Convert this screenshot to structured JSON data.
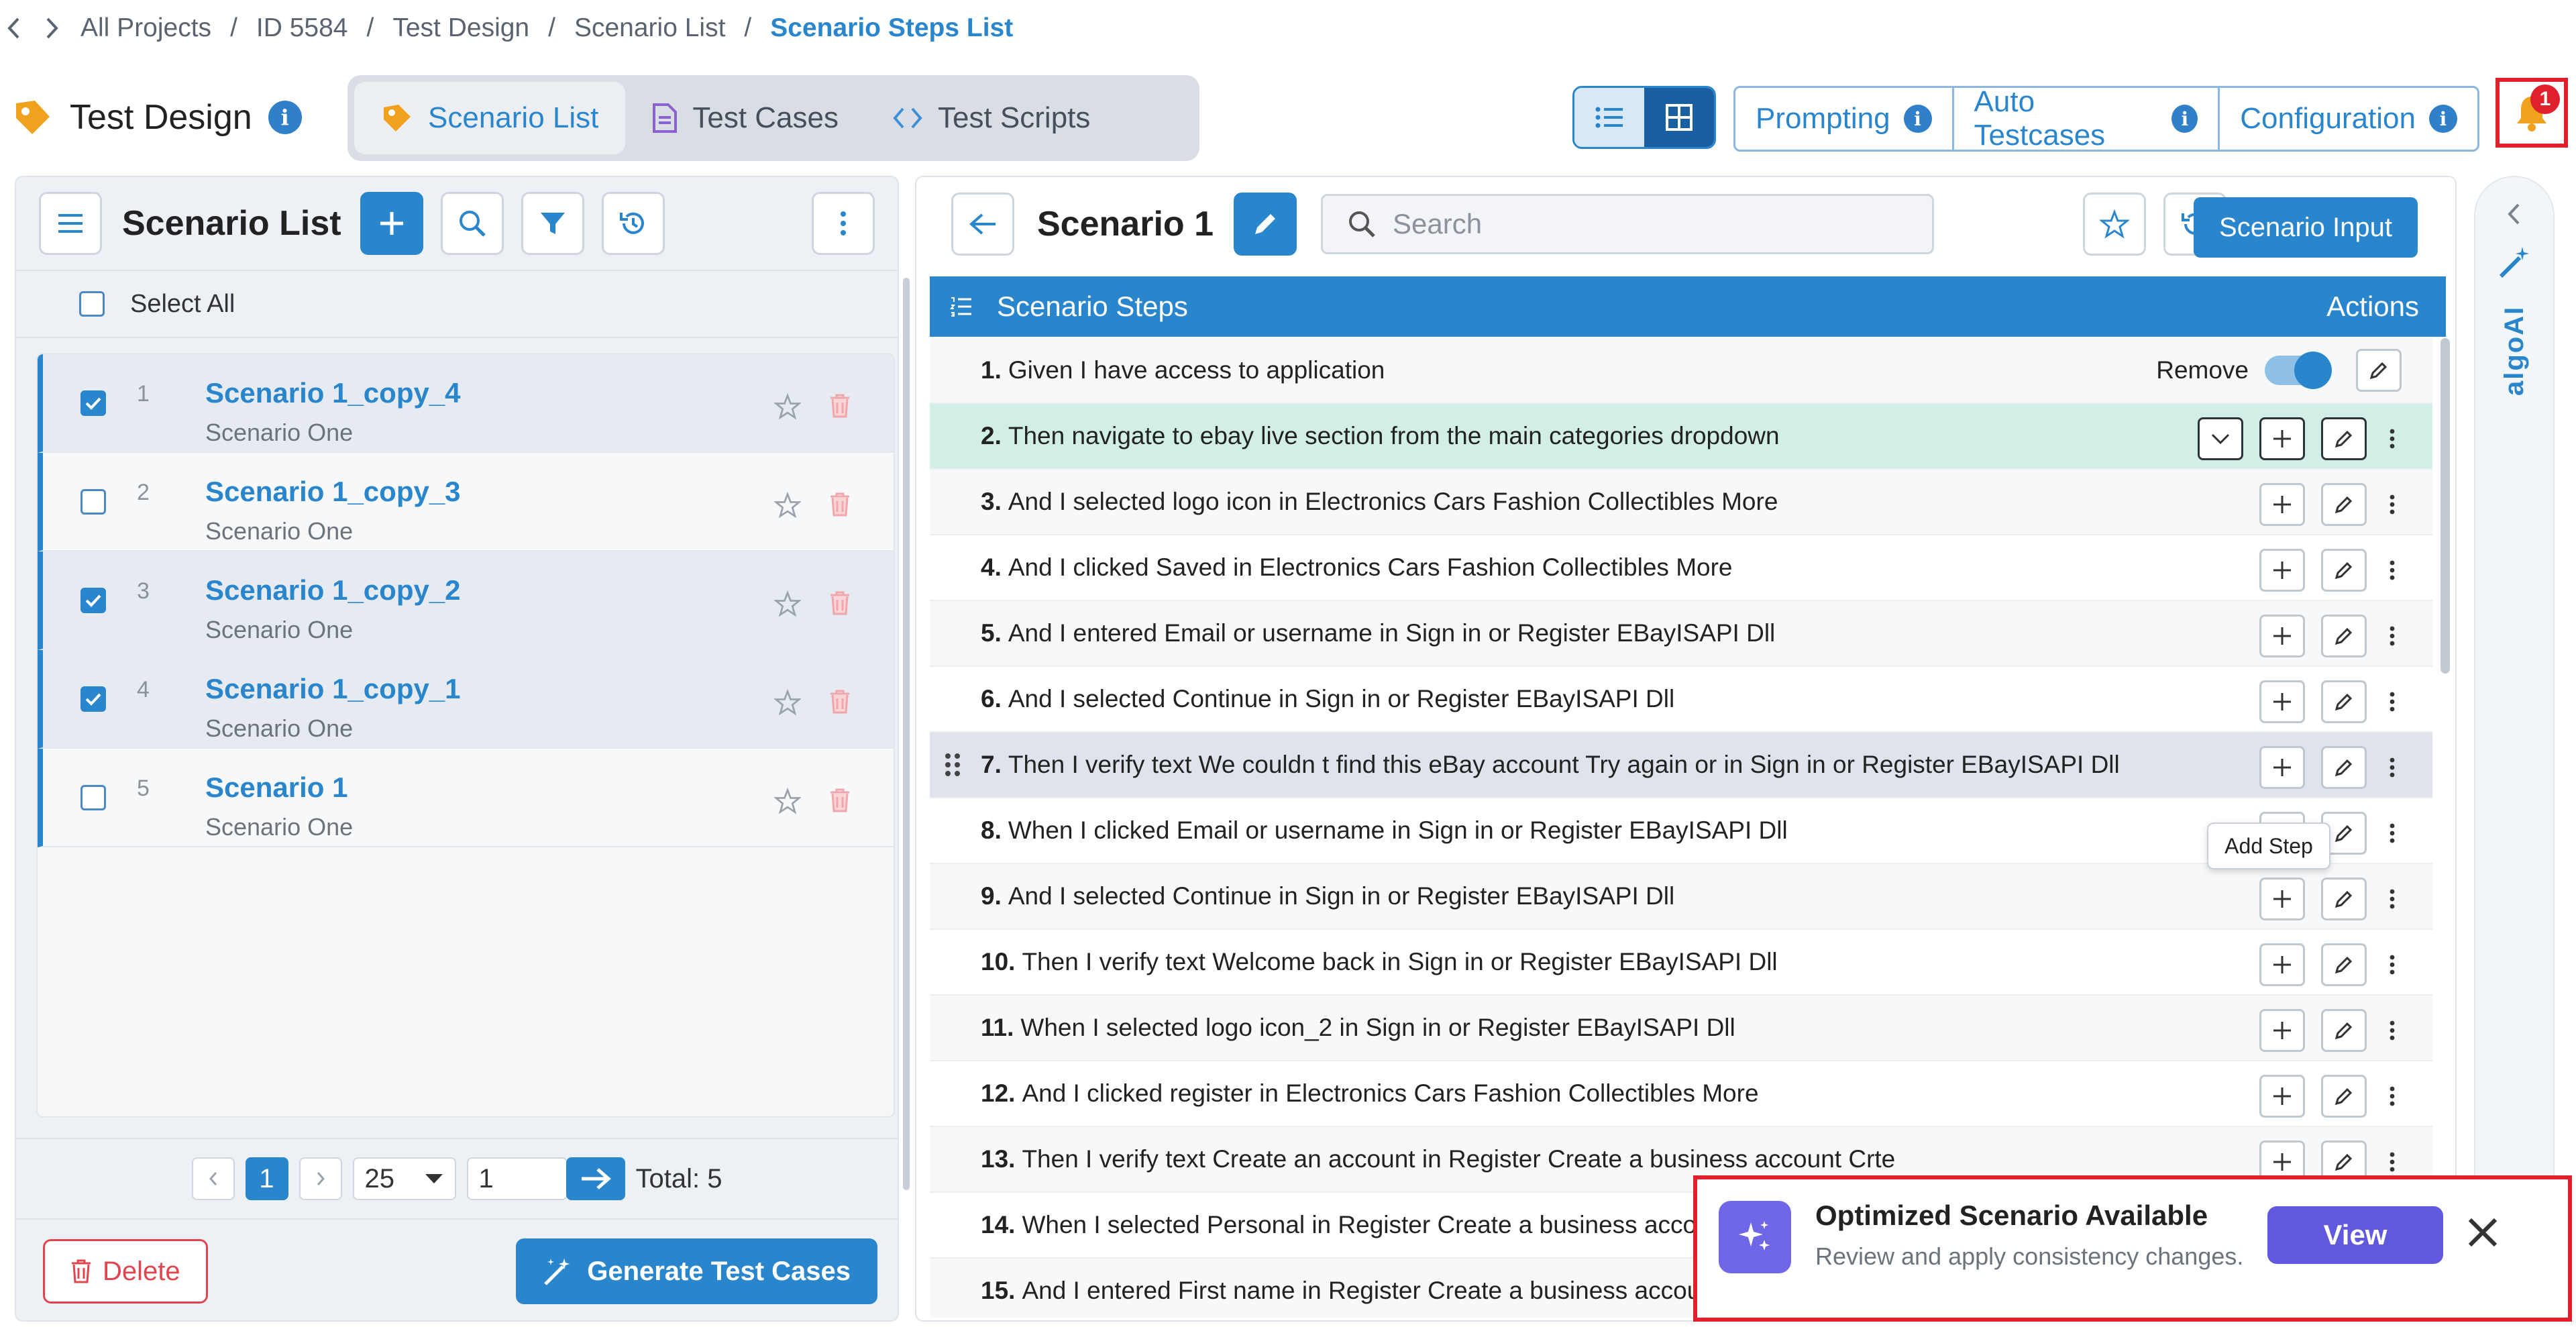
{
  "breadcrumb": {
    "items": [
      "All Projects",
      "ID 5584",
      "Test Design",
      "Scenario List"
    ],
    "current": "Scenario Steps List"
  },
  "header": {
    "app_title": "Test Design",
    "tabs": [
      {
        "label": "Scenario List",
        "active": true
      },
      {
        "label": "Test Cases",
        "active": false
      },
      {
        "label": "Test Scripts",
        "active": false
      }
    ],
    "buttons": [
      "Prompting",
      "Auto Testcases",
      "Configuration"
    ],
    "notification_count": "1"
  },
  "left_panel": {
    "title": "Scenario List",
    "select_all": "Select All",
    "scenarios": [
      {
        "num": "1",
        "name": "Scenario 1_copy_4",
        "sub": "Scenario One",
        "checked": true
      },
      {
        "num": "2",
        "name": "Scenario 1_copy_3",
        "sub": "Scenario One",
        "checked": false
      },
      {
        "num": "3",
        "name": "Scenario 1_copy_2",
        "sub": "Scenario One",
        "checked": true
      },
      {
        "num": "4",
        "name": "Scenario 1_copy_1",
        "sub": "Scenario One",
        "checked": true
      },
      {
        "num": "5",
        "name": "Scenario 1",
        "sub": "Scenario One",
        "checked": false
      }
    ],
    "pager": {
      "current_page": "1",
      "page_size": "25",
      "goto_value": "1",
      "total": "Total: 5"
    },
    "delete_label": "Delete",
    "generate_label": "Generate Test Cases"
  },
  "main": {
    "title": "Scenario 1",
    "search_placeholder": "Search",
    "scenario_input_label": "Scenario Input",
    "steps_header": "Scenario Steps",
    "actions_header": "Actions",
    "remove_label": "Remove",
    "tooltip": "Add Step",
    "steps": [
      {
        "num": "1.",
        "text": "Given I have access to application"
      },
      {
        "num": "2.",
        "text": "Then navigate to ebay live section from the main categories dropdown"
      },
      {
        "num": "3.",
        "text": "And I selected logo icon in Electronics Cars Fashion Collectibles More"
      },
      {
        "num": "4.",
        "text": "And I clicked Saved in Electronics Cars Fashion Collectibles More"
      },
      {
        "num": "5.",
        "text": "And I entered Email or username in Sign in or Register EBayISAPI Dll"
      },
      {
        "num": "6.",
        "text": "And I selected Continue in Sign in or Register EBayISAPI Dll"
      },
      {
        "num": "7.",
        "text": "Then I verify text We couldn t find this eBay account Try again or in Sign in or Register EBayISAPI Dll"
      },
      {
        "num": "8.",
        "text": "When I clicked Email or username in Sign in or Register EBayISAPI Dll"
      },
      {
        "num": "9.",
        "text": "And I selected Continue in Sign in or Register EBayISAPI Dll"
      },
      {
        "num": "10.",
        "text": "Then I verify text Welcome back in Sign in or Register EBayISAPI Dll"
      },
      {
        "num": "11.",
        "text": "When I selected logo icon_2 in Sign in or Register EBayISAPI Dll"
      },
      {
        "num": "12.",
        "text": "And I clicked register in Electronics Cars Fashion Collectibles More"
      },
      {
        "num": "13.",
        "text": "Then I verify text Create an account in Register Create a business account Crte"
      },
      {
        "num": "14.",
        "text": "When I selected Personal in Register Create a business account"
      },
      {
        "num": "15.",
        "text": "And I entered First name in Register Create a business account Crte"
      }
    ]
  },
  "side": {
    "label": "algoAI"
  },
  "toast": {
    "title": "Optimized Scenario Available",
    "subtitle": "Review and apply consistency changes.",
    "view_label": "View"
  },
  "colors": {
    "accent": "#2a86cc",
    "highlight_row": "#d2efe7",
    "alert_red": "#e0202c",
    "toast_purple": "#6158e0"
  }
}
